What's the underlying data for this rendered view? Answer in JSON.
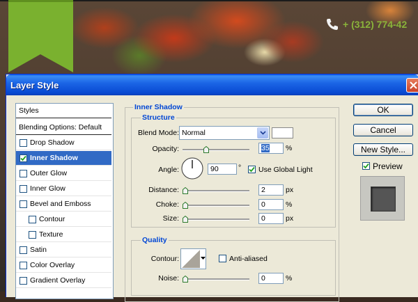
{
  "website": {
    "phone": "+ (312) 774-42",
    "colors": {
      "accent_green": "#7ab12f",
      "phone_green": "#8ab33a"
    }
  },
  "dialog": {
    "title": "Layer Style",
    "left_list": [
      {
        "label": "Styles",
        "type": "heading"
      },
      {
        "label": "Blending Options: Default",
        "type": "heading"
      },
      {
        "label": "Drop Shadow",
        "checked": false,
        "indent": 0
      },
      {
        "label": "Inner Shadow",
        "checked": true,
        "indent": 0,
        "selected": true
      },
      {
        "label": "Outer Glow",
        "checked": false,
        "indent": 0
      },
      {
        "label": "Inner Glow",
        "checked": false,
        "indent": 0
      },
      {
        "label": "Bevel and Emboss",
        "checked": false,
        "indent": 0
      },
      {
        "label": "Contour",
        "checked": false,
        "indent": 1
      },
      {
        "label": "Texture",
        "checked": false,
        "indent": 1
      },
      {
        "label": "Satin",
        "checked": false,
        "indent": 0
      },
      {
        "label": "Color Overlay",
        "checked": false,
        "indent": 0
      },
      {
        "label": "Gradient Overlay",
        "checked": false,
        "indent": 0
      }
    ],
    "inner_shadow": {
      "section_title": "Inner Shadow",
      "structure": {
        "title": "Structure",
        "blend_mode_label": "Blend Mode:",
        "blend_mode_value": "Normal",
        "opacity_label": "Opacity:",
        "opacity_value": "35",
        "opacity_unit": "%",
        "angle_label": "Angle:",
        "angle_value": "90",
        "angle_unit": "°",
        "use_global_light_label": "Use Global Light",
        "use_global_light_checked": true,
        "distance_label": "Distance:",
        "distance_value": "2",
        "distance_unit": "px",
        "choke_label": "Choke:",
        "choke_value": "0",
        "choke_unit": "%",
        "size_label": "Size:",
        "size_value": "0",
        "size_unit": "px"
      },
      "quality": {
        "title": "Quality",
        "contour_label": "Contour:",
        "anti_aliased_label": "Anti-aliased",
        "anti_aliased_checked": false,
        "noise_label": "Noise:",
        "noise_value": "0",
        "noise_unit": "%"
      }
    },
    "buttons": {
      "ok": "OK",
      "cancel": "Cancel",
      "new_style": "New Style...",
      "preview_label": "Preview",
      "preview_checked": true
    },
    "colors": {
      "selection": "#316ac5",
      "group_title": "#0046d5",
      "titlebar": "#0a5ee8"
    }
  }
}
